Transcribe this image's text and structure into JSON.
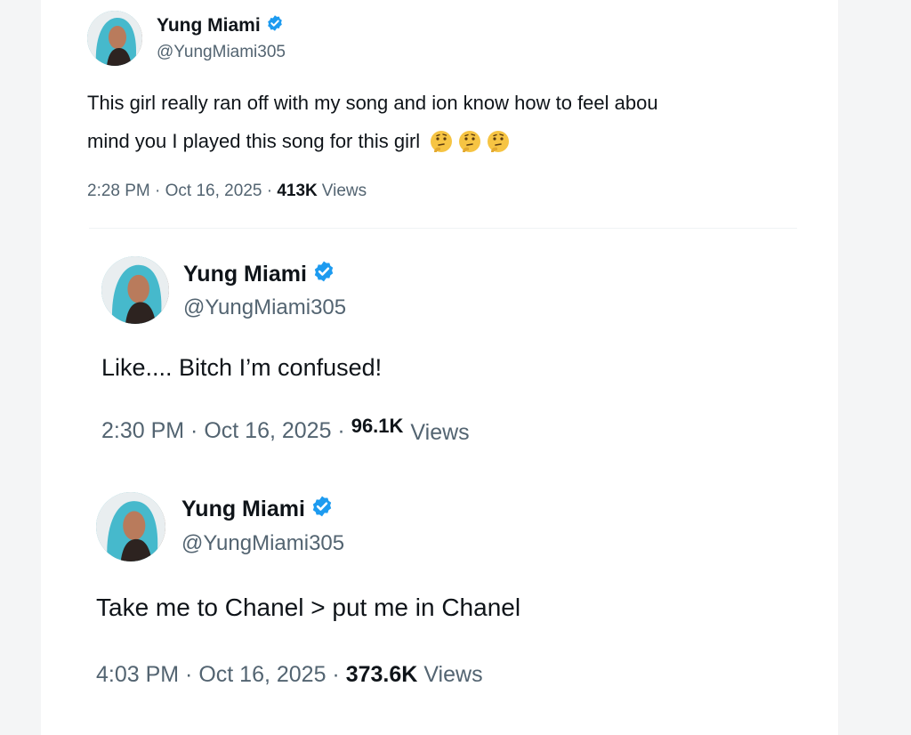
{
  "colors": {
    "verified": "#1d9bf0",
    "text": "#0f1419",
    "secondary": "#536471"
  },
  "tweets": [
    {
      "name": "Yung Miami",
      "handle": "@YungMiami305",
      "line1": "This girl really ran off with my song and ion know how to feel abou",
      "line2": "mind you I played this song for this girl",
      "emojis": [
        "thinking-face-icon",
        "thinking-face-icon",
        "thinking-face-icon"
      ],
      "time": "2:28 PM",
      "dot1": " · ",
      "date": "Oct 16, 2025",
      "dot2": " · ",
      "views_count": "413K",
      "views_label": "Views"
    },
    {
      "name": "Yung Miami",
      "handle": "@YungMiami305",
      "line1": "Like.... Bitch I’m confused!",
      "time": "2:30 PM",
      "dot1": " · ",
      "date": "Oct 16, 2025",
      "dot2": " · ",
      "views_count": "96.1K",
      "views_label": "Views"
    },
    {
      "name": "Yung Miami",
      "handle": "@YungMiami305",
      "line1": "Take me to Chanel > put me in Chanel",
      "time": "4:03 PM",
      "dot1": " · ",
      "date": "Oct 16, 2025",
      "dot2": " · ",
      "views_count": "373.6K",
      "views_label": "Views"
    }
  ]
}
